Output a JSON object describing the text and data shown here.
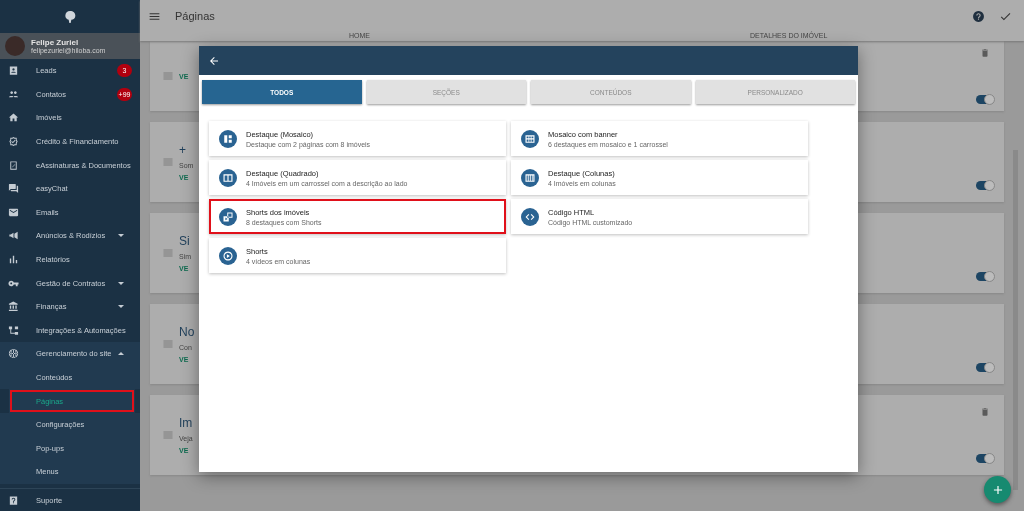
{
  "sidebar": {
    "user": {
      "name": "Felipe Zuriel",
      "email": "felipezuriel@hiloba.com"
    },
    "items": [
      {
        "kind": "link",
        "label": "Leads",
        "badge": "3"
      },
      {
        "kind": "link",
        "label": "Contatos",
        "badge": "+99"
      },
      {
        "kind": "link",
        "label": "Imóveis"
      },
      {
        "kind": "link",
        "label": "Crédito & Financiamento"
      },
      {
        "kind": "link",
        "label": "eAssinaturas & Documentos"
      },
      {
        "kind": "link",
        "label": "easyChat"
      },
      {
        "kind": "link",
        "label": "Emails"
      },
      {
        "kind": "group",
        "label": "Anúncios & Rodízios",
        "expanded": false
      },
      {
        "kind": "link",
        "label": "Relatórios"
      },
      {
        "kind": "group",
        "label": "Gestão de Contratos",
        "expanded": false
      },
      {
        "kind": "group",
        "label": "Finanças",
        "expanded": false
      },
      {
        "kind": "link",
        "label": "Integrações & Automações"
      },
      {
        "kind": "group",
        "label": "Gerenciamento do site",
        "expanded": true,
        "children": [
          {
            "label": "Conteúdos",
            "selected": false,
            "highlighted": false
          },
          {
            "label": "Páginas",
            "selected": true,
            "highlighted": true
          },
          {
            "label": "Configurações",
            "selected": false,
            "highlighted": false
          },
          {
            "label": "Pop-ups",
            "selected": false,
            "highlighted": false
          },
          {
            "label": "Menus",
            "selected": false,
            "highlighted": false
          }
        ]
      }
    ],
    "footer": {
      "label": "Suporte"
    }
  },
  "topbar": {
    "title": "Páginas",
    "tabs": [
      {
        "label": "HOME"
      },
      {
        "label": "DETALHES DO IMÓVEL"
      }
    ]
  },
  "cards": [
    {
      "link": "VE",
      "on": true,
      "trash": true
    },
    {
      "title": "+",
      "subtitle": "Som",
      "link": "VE",
      "on": true,
      "trash": false
    },
    {
      "title": "Si",
      "subtitle": "Sim",
      "link": "VE",
      "on": true,
      "trash": false
    },
    {
      "title": "No",
      "subtitle": "Con",
      "link": "VE",
      "on": true,
      "trash": false
    },
    {
      "title": "Im",
      "subtitle": "Veja",
      "link": "VE",
      "on": true,
      "trash": true
    }
  ],
  "modal": {
    "tabs": [
      {
        "label": "TODOS",
        "selected": true
      },
      {
        "label": "SEÇÕES",
        "selected": false
      },
      {
        "label": "CONTEÚDOS",
        "selected": false
      },
      {
        "label": "PERSONALIZADO",
        "selected": false
      }
    ],
    "options": [
      {
        "title": "Destaque (Mosaico)",
        "description": "Destaque com 2 páginas com 8 imóveis",
        "highlighted": false
      },
      {
        "title": "Mosaico com banner",
        "description": "6 destaques em mosaico e 1 carrossel",
        "highlighted": false
      },
      {
        "title": "Destaque (Quadrado)",
        "description": "4 Imóveis em um carrossel com a descrição ao lado",
        "highlighted": false
      },
      {
        "title": "Destaque (Colunas)",
        "description": "4 Imóveis em colunas",
        "highlighted": false
      },
      {
        "title": "Shorts dos imóveis",
        "description": "8 destaques com Shorts",
        "highlighted": true
      },
      {
        "title": "Código HTML",
        "description": "Código HTML customizado",
        "highlighted": false
      },
      {
        "title": "Shorts",
        "description": "4 vídeos em colunas",
        "highlighted": false
      }
    ]
  }
}
